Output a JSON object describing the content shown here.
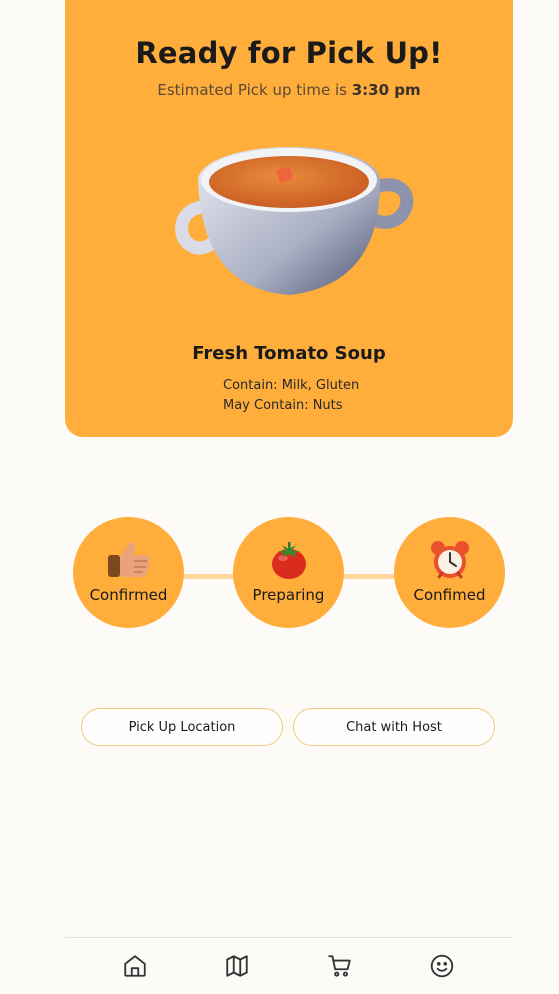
{
  "hero": {
    "title": "Ready for Pick Up!",
    "subtitle_prefix": "Estimated Pick up time is ",
    "pickup_time": "3:30 pm",
    "dish_image_icon": "tomato-soup-bowl-image",
    "dish_name": "Fresh Tomato Soup",
    "contains": "Contain: Milk, Gluten",
    "may_contain": "May Contain: Nuts",
    "background_color": "#ffad3b"
  },
  "progress": {
    "steps": [
      {
        "label": "Confirmed",
        "icon": "thumbs-up-icon"
      },
      {
        "label": "Preparing",
        "icon": "tomato-icon"
      },
      {
        "label": "Confimed",
        "icon": "alarm-clock-icon"
      }
    ],
    "step_color": "#ffad3b",
    "connector_color": "#ffd79d"
  },
  "actions": {
    "pickup_location_label": "Pick Up Location",
    "chat_host_label": "Chat with Host"
  },
  "bottom_nav": {
    "items": [
      {
        "icon": "home-icon"
      },
      {
        "icon": "map-icon"
      },
      {
        "icon": "cart-icon"
      },
      {
        "icon": "smiley-icon"
      }
    ]
  }
}
